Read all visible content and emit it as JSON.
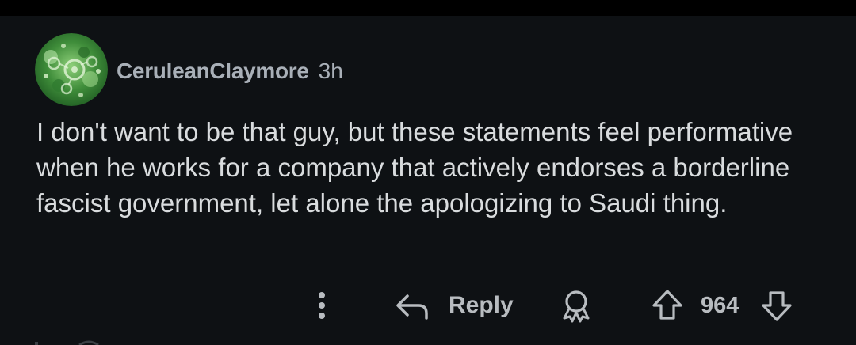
{
  "comment": {
    "author": "CeruleanClaymore",
    "age": "3h",
    "body": "I don't want to be that guy, but these statements feel performative when he works for a company that actively endorses a borderline fascist government, let alone the apologizing to Saudi thing."
  },
  "actions": {
    "more_icon": "more-vertical-icon",
    "reply_icon": "reply-arrow-icon",
    "reply_label": "Reply",
    "award_icon": "award-icon",
    "upvote_icon": "upvote-arrow-icon",
    "score": "964",
    "downvote_icon": "downvote-arrow-icon"
  },
  "colors": {
    "background": "#0e1114",
    "text": "#d9dcde",
    "meta": "#a9b0b8",
    "action": "#b8bcc0"
  }
}
